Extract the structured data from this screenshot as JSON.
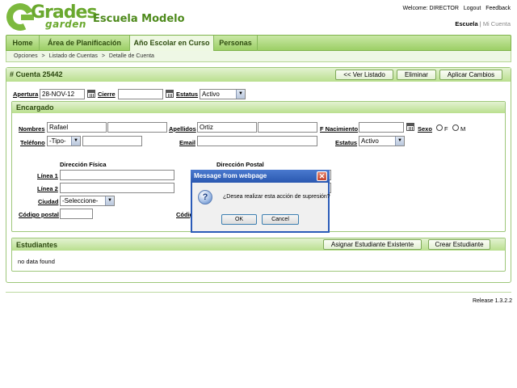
{
  "header": {
    "logo_main": "Grades",
    "logo_sub": "garden",
    "school_name": "Escuela Modelo",
    "welcome": "Welcome: DIRECTOR",
    "logout": "Logout",
    "feedback": "Feedback",
    "school_link": "Escuela",
    "separator": "|",
    "my_account": "Mi Cuenta"
  },
  "nav": {
    "items": [
      "Home",
      "Área de Planificación",
      "Año Escolar en Curso",
      "Personas"
    ],
    "active_index": 2
  },
  "breadcrumb": {
    "items": [
      "Opciones",
      "Listado de Cuentas",
      "Detalle de Cuenta"
    ],
    "separator": ">"
  },
  "account": {
    "title": "# Cuenta 25442",
    "buttons": [
      "<< Ver Listado",
      "Eliminar",
      "Aplicar Cambios"
    ],
    "apertura_label": "Apertura",
    "apertura_value": "28-NOV-12",
    "cierre_label": "Cierre",
    "cierre_value": "",
    "estatus_label": "Estatus",
    "estatus_value": "Activo"
  },
  "encargado": {
    "title": "Encargado",
    "nombres_label": "Nombres",
    "nombres_value": "Rafael",
    "nombres_value2": "",
    "apellidos_label": "Apellidos",
    "apellidos_value": "Ortiz",
    "apellidos_value2": "",
    "nacimiento_label": "F Nacimiento",
    "nacimiento_value": "",
    "sexo_label": "Sexo",
    "sexo_f": "F",
    "sexo_m": "M",
    "telefono_label": "Teléfono",
    "telefono_tipo": "-Tipo-",
    "telefono_value": "",
    "email_label": "Email",
    "email_value": "",
    "estatus_label": "Estatus",
    "estatus_value": "Activo",
    "dir_fisica": "Dirección Física",
    "dir_postal": "Dirección Postal",
    "linea1_label": "Línea 1",
    "linea2_label": "Línea 2",
    "ciudad_label": "Ciudad",
    "ciudad_value": "-Seleccione-",
    "codigo_label": "Código postal",
    "codigo_label2": "Códig"
  },
  "estudiantes": {
    "title": "Estudiantes",
    "buttons": [
      "Asignar Estudiante Existente",
      "Crear Estudiante"
    ],
    "empty": "no data found"
  },
  "dialog": {
    "title": "Message from webpage",
    "message": "¿Desea realizar esta acción de supresión?",
    "ok": "OK",
    "cancel": "Cancel",
    "close": "✕",
    "icon_glyph": "?"
  },
  "footer": {
    "release": "Release 1.3.2.2"
  },
  "colors": {
    "accent_green": "#7cb93e",
    "header_green": "#b9df8e",
    "dialog_blue": "#2b5bb8"
  }
}
